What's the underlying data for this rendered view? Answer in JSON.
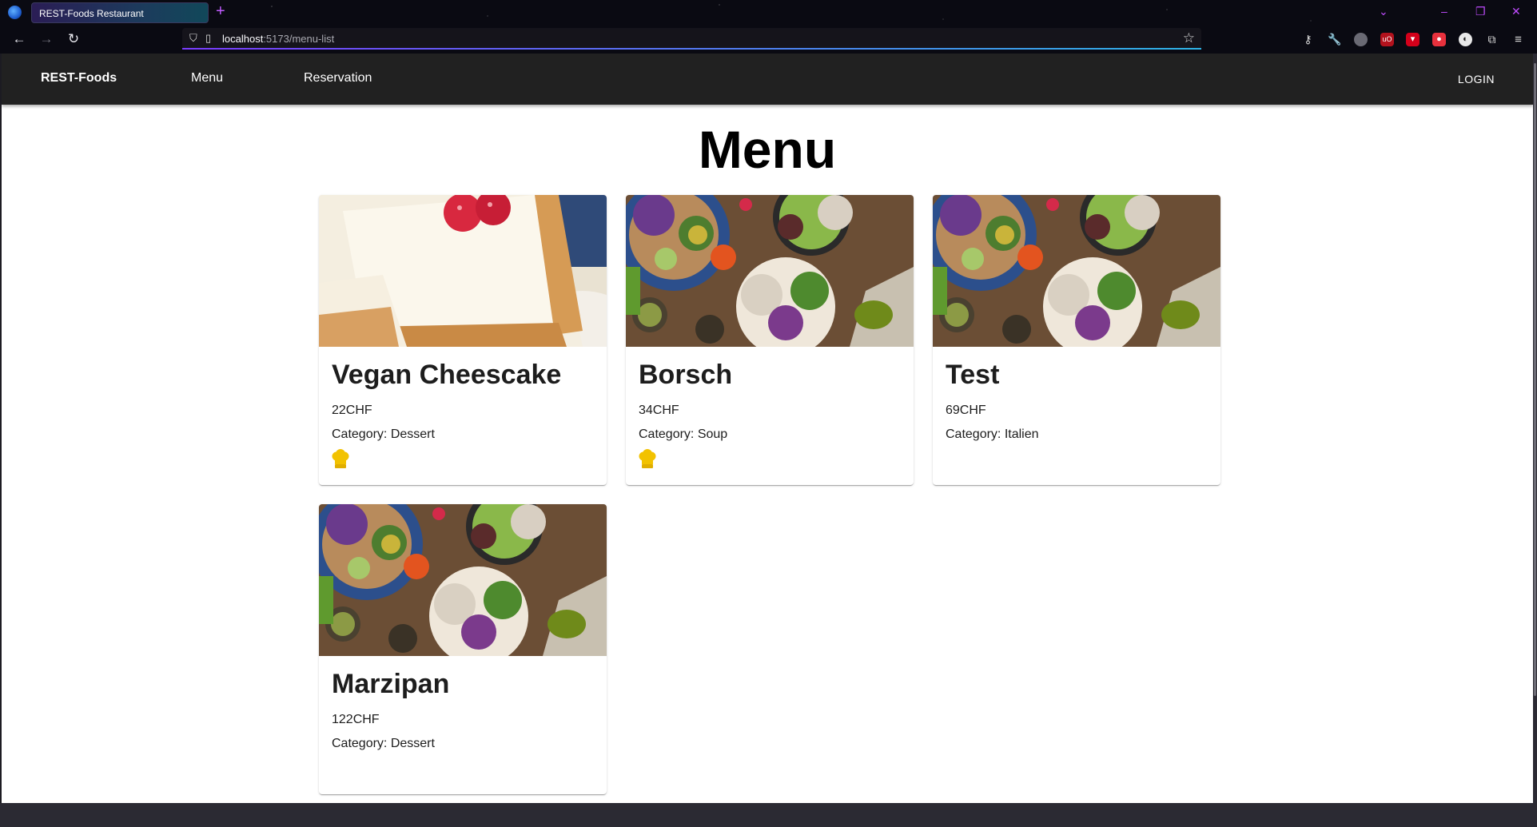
{
  "browser": {
    "tab_title": "REST-Foods Restaurant",
    "url_host": "localhost",
    "url_path": ":5173/menu-list"
  },
  "app": {
    "brand": "REST-Foods",
    "nav": [
      "Menu",
      "Reservation"
    ],
    "login": "LOGIN"
  },
  "page": {
    "title": "Menu"
  },
  "menu_items": [
    {
      "name": "Vegan Cheescake",
      "price": "22CHF",
      "category": "Category: Dessert",
      "image": "cheesecake",
      "chef_icon": true
    },
    {
      "name": "Borsch",
      "price": "34CHF",
      "category": "Category: Soup",
      "image": "salad-bowls",
      "chef_icon": true
    },
    {
      "name": "Test",
      "price": "69CHF",
      "category": "Category: Italien",
      "image": "salad-bowls",
      "chef_icon": false
    },
    {
      "name": "Marzipan",
      "price": "122CHF",
      "category": "Category: Dessert",
      "image": "salad-bowls",
      "chef_icon": false
    }
  ],
  "colors": {
    "appbar": "#212121",
    "chef_icon": "#f2c200"
  }
}
